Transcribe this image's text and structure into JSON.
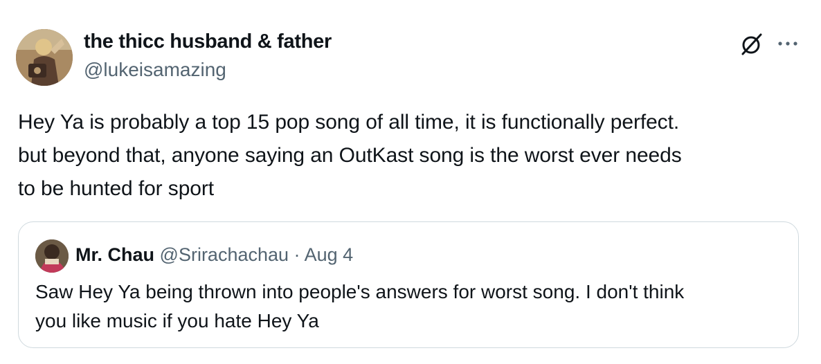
{
  "author": {
    "display_name": "the thicc husband & father",
    "handle": "@lukeisamazing",
    "avatar_icon": "avatar-image"
  },
  "actions": {
    "grok_icon": "grok-icon",
    "more_icon": "more-options-icon"
  },
  "tweet": {
    "lines": [
      "Hey Ya is probably a top 15 pop song of all time, it is functionally perfect.",
      "but beyond that, anyone saying an OutKast song is the worst ever needs",
      "to be hunted for sport"
    ]
  },
  "quoted": {
    "display_name": "Mr. Chau",
    "handle": "@Srirachachau",
    "separator": "·",
    "date": "Aug 4",
    "lines": [
      "Saw Hey Ya being thrown into people's answers for worst song. I don't think",
      "you like music if you hate Hey Ya"
    ]
  },
  "colors": {
    "text_primary": "#0f1419",
    "text_secondary": "#536471",
    "border": "#cfd9de"
  }
}
